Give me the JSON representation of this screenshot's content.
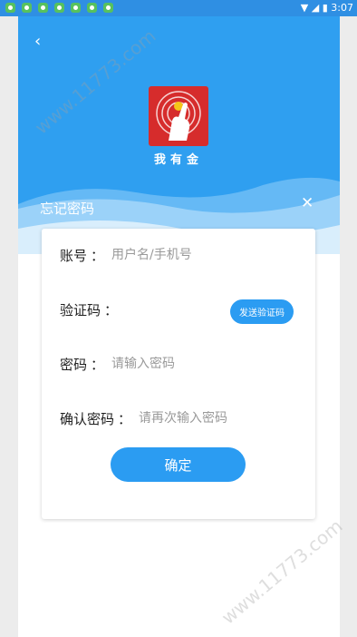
{
  "status_bar": {
    "time": "3:07"
  },
  "logo": {
    "name": "我有金"
  },
  "header": {
    "title": "忘记密码"
  },
  "form": {
    "account": {
      "label": "账号",
      "colon": "：",
      "placeholder": "用户名/手机号"
    },
    "code": {
      "label": "验证码",
      "colon": "：",
      "send_label": "发送验证码"
    },
    "password": {
      "label": "密码",
      "colon": "：",
      "placeholder": "请输入密码"
    },
    "confirm_password": {
      "label": "确认密码",
      "colon": "：",
      "placeholder": "请再次输入密码"
    },
    "submit_label": "确定"
  },
  "watermark": {
    "text": "www.11773.com"
  },
  "colors": {
    "primary": "#2f9ff0",
    "button": "#2b9cf2",
    "logo_bg": "#d62c2c"
  },
  "icons": [
    "back-chevron-icon",
    "close-icon",
    "app-logo-icon"
  ]
}
